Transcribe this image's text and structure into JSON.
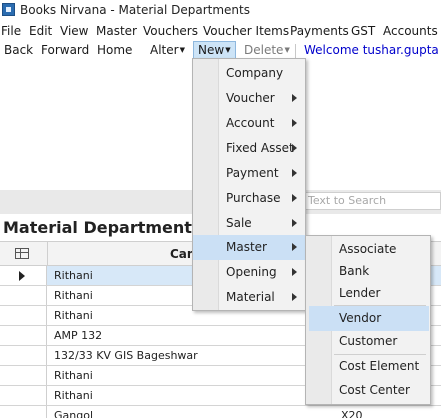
{
  "window": {
    "title": "Books Nirvana - Material Departments"
  },
  "menubar": [
    "File",
    "Edit",
    "View",
    "Master",
    "Vouchers",
    "Voucher Items",
    "Payments",
    "GST",
    "Accounts"
  ],
  "toolbar": {
    "back": "Back",
    "forward": "Forward",
    "home": "Home",
    "alter": "Alter",
    "new": "New",
    "delete": "Delete",
    "welcome": "Welcome tushar.gupta ON"
  },
  "search": {
    "placeholder": "Text to Search"
  },
  "panel": {
    "title": "Material Departments"
  },
  "grid": {
    "column_header": "Cam",
    "rows": [
      {
        "name": "Rithani",
        "extra": ""
      },
      {
        "name": "Rithani",
        "extra": ""
      },
      {
        "name": "Rithani",
        "extra": ""
      },
      {
        "name": "AMP 132",
        "extra": ""
      },
      {
        "name": "132/33 KV GIS Bageshwar",
        "extra": ""
      },
      {
        "name": "Rithani",
        "extra": ""
      },
      {
        "name": "Rithani",
        "extra": ""
      },
      {
        "name": "Gangol",
        "extra": "X20"
      }
    ]
  },
  "new_menu": {
    "items": [
      {
        "label": "Company",
        "submenu": false
      },
      {
        "label": "Voucher",
        "submenu": true
      },
      {
        "label": "Account",
        "submenu": true
      },
      {
        "label": "Fixed Asset",
        "submenu": true
      },
      {
        "label": "Payment",
        "submenu": true
      },
      {
        "label": "Purchase",
        "submenu": true
      },
      {
        "label": "Sale",
        "submenu": true
      },
      {
        "label": "Master",
        "submenu": true,
        "highlighted": true
      },
      {
        "label": "Opening",
        "submenu": true
      },
      {
        "label": "Material",
        "submenu": true
      }
    ]
  },
  "master_menu": {
    "items": [
      {
        "label": "Associate"
      },
      {
        "label": "Bank"
      },
      {
        "label": "Lender"
      },
      {
        "label": "Vendor",
        "highlighted": true
      },
      {
        "label": "Customer"
      },
      {
        "label": "Cost Element"
      },
      {
        "label": "Cost Center"
      }
    ]
  },
  "colors": {
    "selection": "#cbe0f5",
    "welcome_link": "#0000cc",
    "row_selected": "#d7e8f8"
  }
}
